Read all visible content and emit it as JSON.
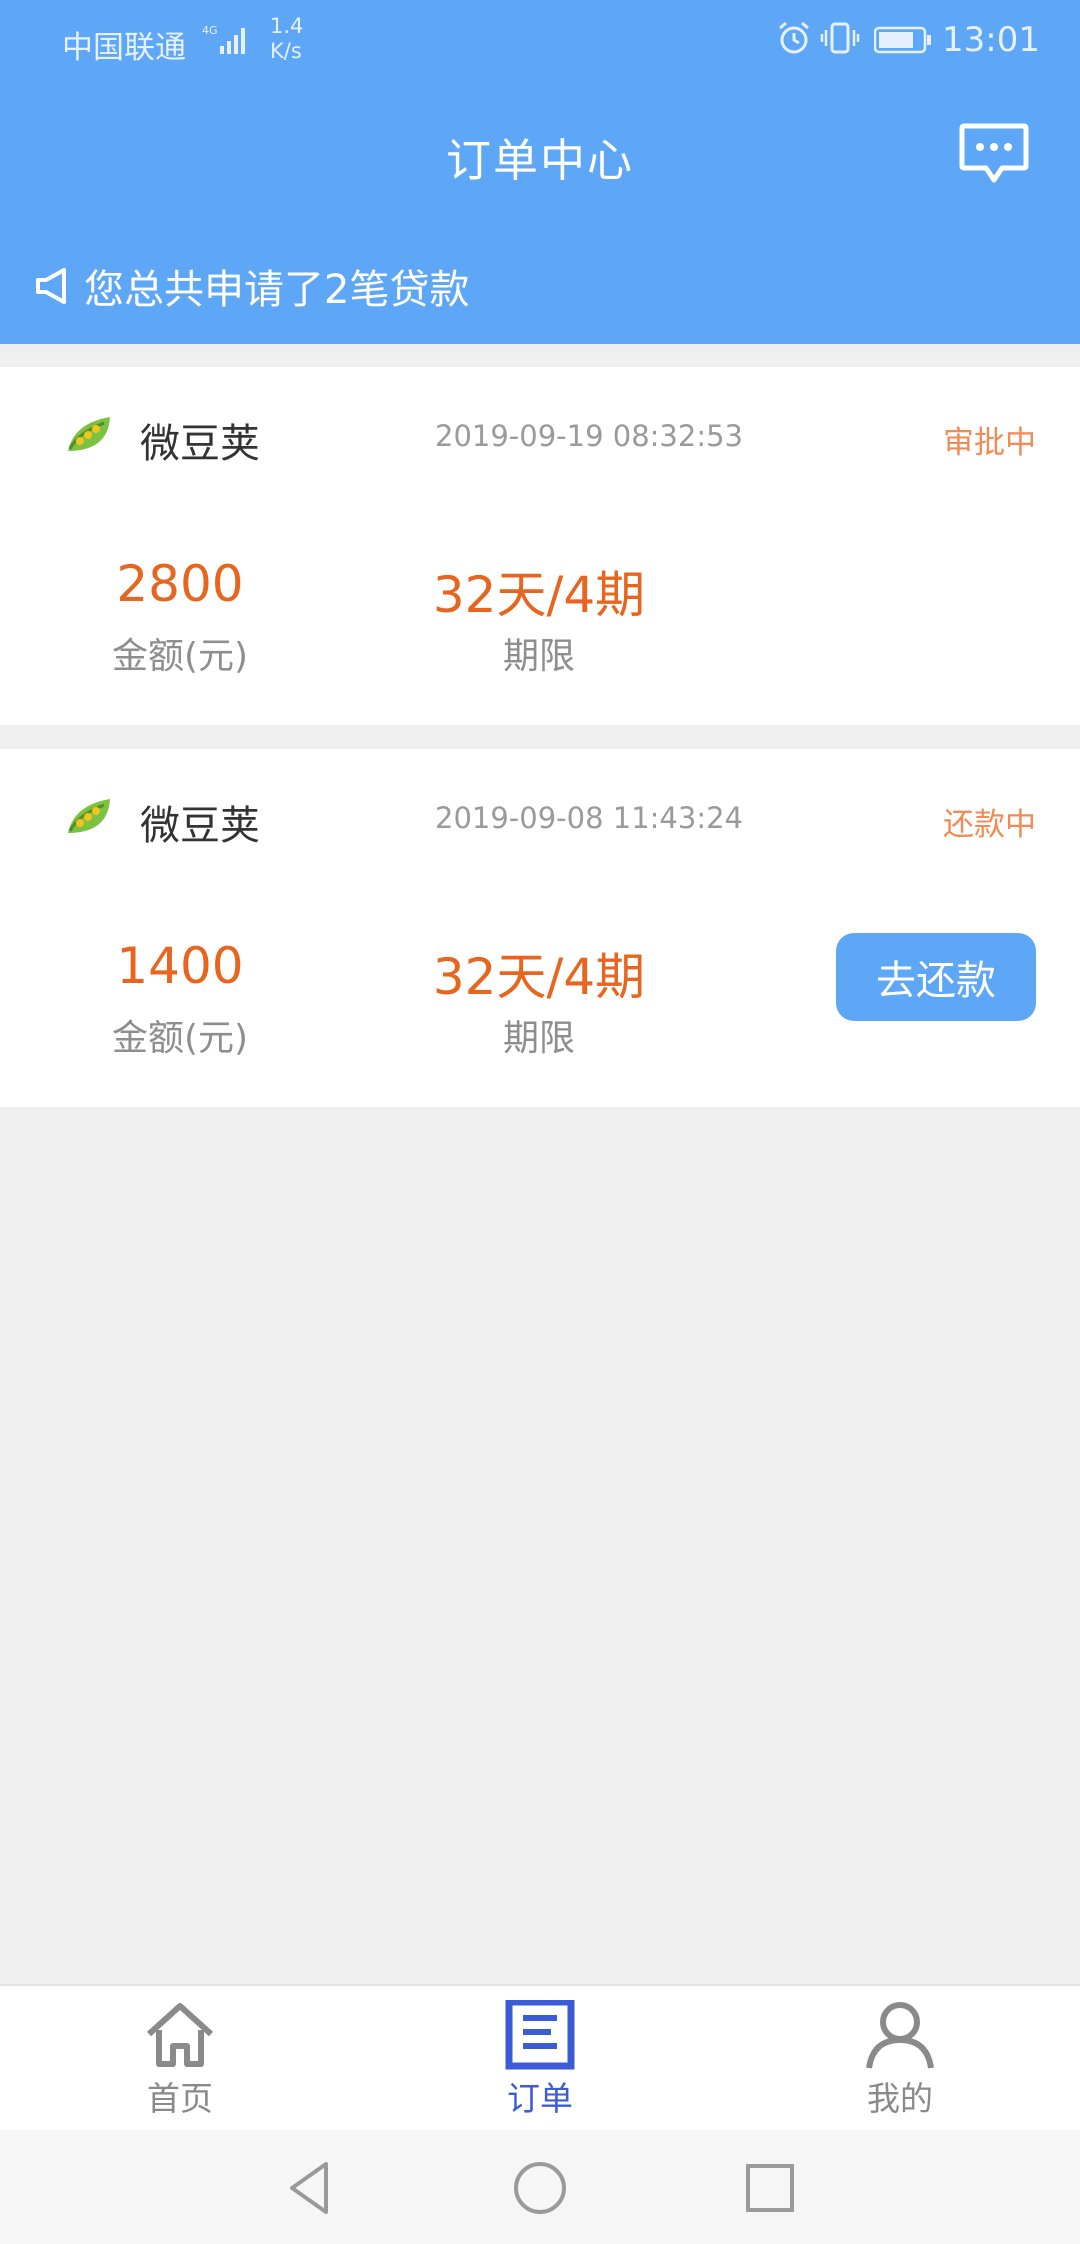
{
  "status_bar": {
    "carrier": "中国联通",
    "network": "4G",
    "speed_value": "1.4",
    "speed_unit": "K/s",
    "time": "13:01"
  },
  "header": {
    "title": "订单中心",
    "message_icon": "chat-bubble-icon"
  },
  "notice": {
    "icon": "megaphone-icon",
    "text": "您总共申请了2笔贷款"
  },
  "orders": [
    {
      "product": "微豆荚",
      "time": "2019-09-19 08:32:53",
      "status": "审批中",
      "amount": "2800",
      "amount_label": "金额(元)",
      "term": "32天/4期",
      "term_label": "期限"
    },
    {
      "product": "微豆荚",
      "time": "2019-09-08 11:43:24",
      "status": "还款中",
      "amount": "1400",
      "amount_label": "金额(元)",
      "term": "32天/4期",
      "term_label": "期限",
      "action_label": "去还款"
    }
  ],
  "tabbar": {
    "items": [
      {
        "label": "首页",
        "icon": "home-icon",
        "active": false
      },
      {
        "label": "订单",
        "icon": "order-list-icon",
        "active": true
      },
      {
        "label": "我的",
        "icon": "person-icon",
        "active": false
      }
    ]
  },
  "navbar": {
    "icons": [
      "back-triangle-icon",
      "home-circle-icon",
      "recent-square-icon"
    ]
  },
  "colors": {
    "header_blue": "#5ea7f7",
    "accent_orange": "#e8651f",
    "status_orange": "#f18a55",
    "active_tab": "#3c5bd6"
  }
}
